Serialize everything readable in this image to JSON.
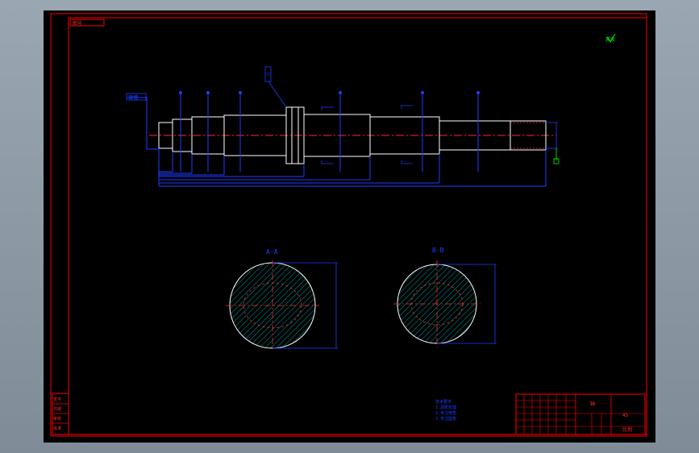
{
  "colors": {
    "frame": "#ff0000",
    "part": "#ffffff",
    "centerline": "#ff2a2a",
    "dimension": "#1e3cff",
    "annotation_green": "#00ff00",
    "hatch": "#00a0a0",
    "canvas": "#000000"
  },
  "title_box": {
    "tag": "图号"
  },
  "roughness_mark": {
    "label": "其余"
  },
  "shaft": {
    "left_leader_label": "键槽",
    "top_tag_label": "□□",
    "segments": 11,
    "notes_top": [
      "—",
      "—"
    ],
    "notes_bottom": [
      "—",
      "—"
    ]
  },
  "sections": [
    {
      "label": "A-A"
    },
    {
      "label": "B-B"
    }
  ],
  "tech_notes": {
    "lines": [
      "技术要求",
      "1.调质处理",
      "2.未注倒角",
      "3.未注圆角"
    ]
  },
  "title_block": {
    "name": "轴",
    "material": "45",
    "drawing_no": "比例"
  },
  "side_block": {
    "rows": [
      "签字",
      "日期",
      "审核",
      "批准"
    ]
  }
}
